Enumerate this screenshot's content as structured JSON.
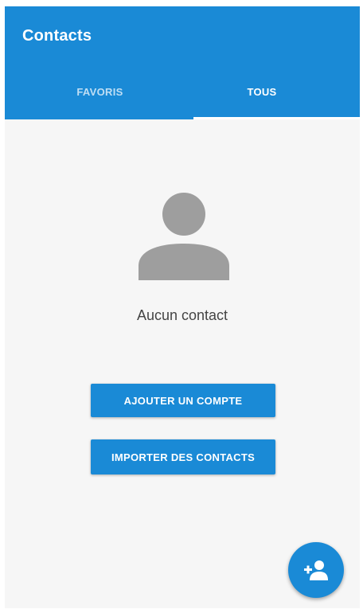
{
  "app": {
    "title": "Contacts"
  },
  "tabs": [
    {
      "label": "FAVORIS",
      "selected": false
    },
    {
      "label": "TOUS",
      "selected": true
    }
  ],
  "empty_state": {
    "icon": "person-icon",
    "message": "Aucun contact"
  },
  "buttons": {
    "add_account": "AJOUTER UN COMPTE",
    "import_contacts": "IMPORTER DES CONTACTS"
  },
  "fab": {
    "icon": "add-person-icon"
  },
  "colors": {
    "primary": "#1a8ad6",
    "background": "#f6f6f6",
    "icon_gray": "#9e9e9e"
  }
}
